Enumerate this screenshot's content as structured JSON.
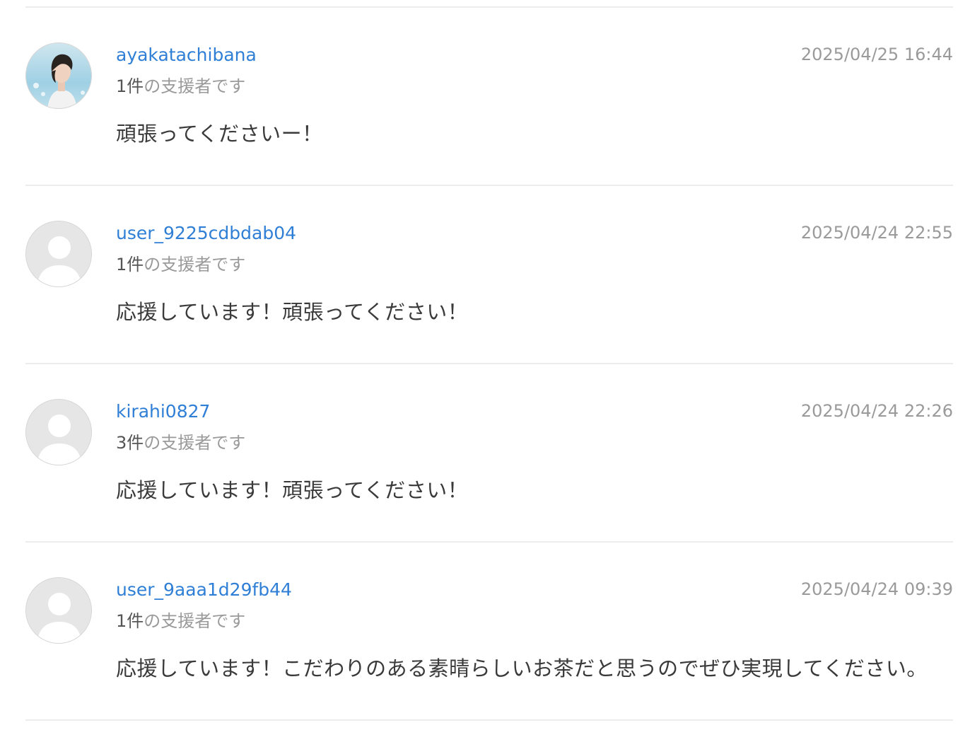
{
  "supporters": [
    {
      "username": "ayakatachibana",
      "support_count": "1件",
      "support_suffix": "の支援者です",
      "timestamp": "2025/04/25 16:44",
      "comment": "頑張ってくださいー！",
      "avatar": "photo"
    },
    {
      "username": "user_9225cdbdab04",
      "support_count": "1件",
      "support_suffix": "の支援者です",
      "timestamp": "2025/04/24 22:55",
      "comment": "応援しています！頑張ってください！",
      "avatar": "default-user-icon"
    },
    {
      "username": "kirahi0827",
      "support_count": "3件",
      "support_suffix": "の支援者です",
      "timestamp": "2025/04/24 22:26",
      "comment": "応援しています！頑張ってください！",
      "avatar": "default-user-icon"
    },
    {
      "username": "user_9aaa1d29fb44",
      "support_count": "1件",
      "support_suffix": "の支援者です",
      "timestamp": "2025/04/24 09:39",
      "comment": "応援しています！こだわりのある素晴らしいお茶だと思うのでぜひ実現してください。",
      "avatar": "default-user-icon"
    }
  ],
  "colors": {
    "link": "#2f7fd6",
    "muted": "#9a9a9a",
    "text": "#3a3a3a",
    "divider": "#ececec"
  }
}
